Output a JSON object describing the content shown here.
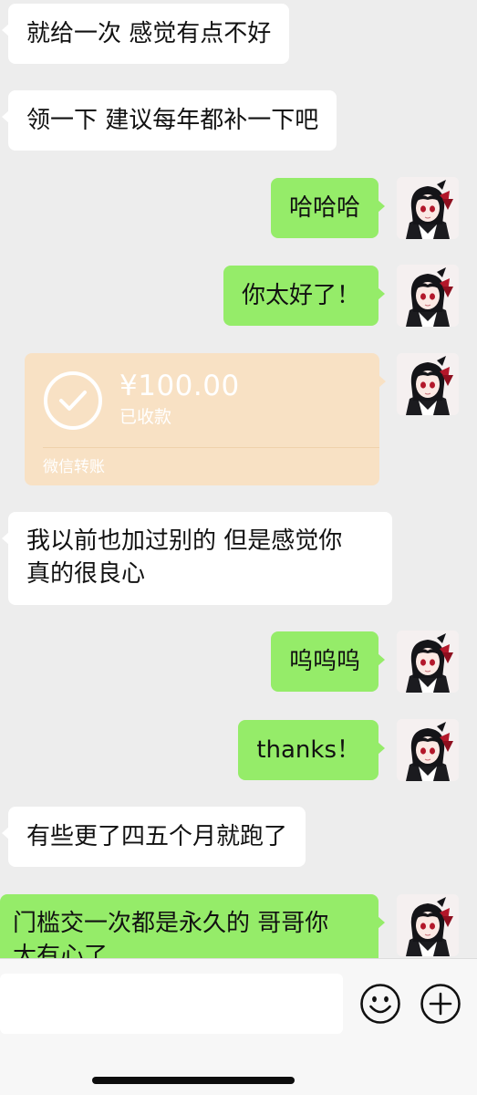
{
  "messages": [
    {
      "side": "left",
      "text": "就给一次 感觉有点不好"
    },
    {
      "side": "left",
      "text": "领一下 建议每年都补一下吧"
    },
    {
      "side": "right",
      "text": "哈哈哈"
    },
    {
      "side": "right",
      "text": "你太好了！"
    },
    {
      "side": "right",
      "type": "transfer",
      "amount": "¥100.00",
      "status": "已收款",
      "label": "微信转账"
    },
    {
      "side": "left",
      "line1": "我以前也加过别的 但是感觉你",
      "line2": "真的很良心"
    },
    {
      "side": "right",
      "text": "呜呜呜"
    },
    {
      "side": "right",
      "text": "thanks！"
    },
    {
      "side": "left",
      "text": "有些更了四五个月就跑了"
    },
    {
      "side": "right",
      "line1": "门槛交一次都是永久的 哥哥你",
      "line2": "太有心了"
    }
  ],
  "input": {
    "placeholder": ""
  },
  "icons": {
    "emoji": "emoji-icon",
    "plus": "plus-icon",
    "check": "check-icon"
  },
  "colors": {
    "background": "#ededed",
    "outgoing_bubble": "#95ec69",
    "incoming_bubble": "#ffffff",
    "transfer_card": "#f8e1c4"
  }
}
